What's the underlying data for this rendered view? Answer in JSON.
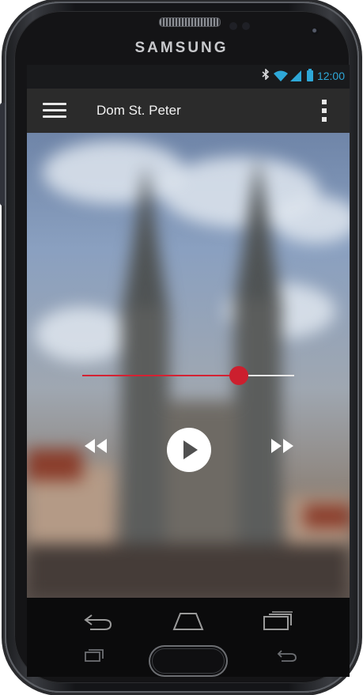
{
  "device": {
    "brand": "SAMSUNG"
  },
  "status_bar": {
    "time": "12:00",
    "icons": [
      "bluetooth-icon",
      "wifi-icon",
      "signal-icon",
      "battery-icon"
    ]
  },
  "app_bar": {
    "title": "Dom St. Peter"
  },
  "player": {
    "progress_fraction": 0.74
  },
  "colors": {
    "accent": "#cc1f2e",
    "appbar": "#2b2b2b",
    "status": "#2ea8d8"
  },
  "nav_icons": [
    "back-icon",
    "home-icon",
    "recent-apps-icon"
  ],
  "hardware_keys": [
    "recent-apps-hardware-icon",
    "home-hardware-button",
    "back-hardware-icon"
  ]
}
